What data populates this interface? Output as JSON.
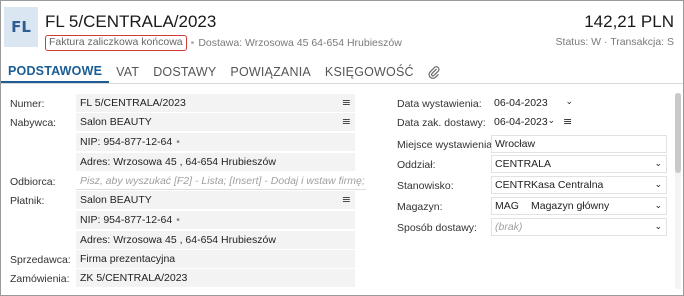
{
  "header": {
    "icon_text": "FL",
    "title": "FL 5/CENTRALA/2023",
    "doc_type": "Faktura zaliczkowa końcowa",
    "delivery": "Dostawa: Wrzosowa  45  64-654 Hrubieszów",
    "amount": "142,21 PLN",
    "status": "Status:  W  ·  Transakcja:  S"
  },
  "tabs": [
    {
      "label": "PODSTAWOWE",
      "active": true
    },
    {
      "label": "VAT"
    },
    {
      "label": "DOSTAWY"
    },
    {
      "label": "POWIĄZANIA"
    },
    {
      "label": "KSIĘGOWOŚĆ"
    }
  ],
  "left": {
    "numer_label": "Numer:",
    "numer_value": "FL 5/CENTRALA/2023",
    "nabywca_label": "Nabywca:",
    "nabywca_name": "Salon BEAUTY",
    "nabywca_nip": "NIP:  954-877-12-64",
    "nabywca_addr": "Adres:  Wrzosowa  45 , 64-654 Hrubieszów",
    "odbiorca_label": "Odbiorca:",
    "odbiorca_placeholder": "Pisz, aby wyszukać [F2] - Lista; [Insert] - Dodaj i wstaw firmę;",
    "platnik_label": "Płatnik:",
    "platnik_name": "Salon BEAUTY",
    "platnik_nip": "NIP:  954-877-12-64",
    "platnik_addr": "Adres:  Wrzosowa  45 , 64-654 Hrubieszów",
    "sprzedawca_label": "Sprzedawca:",
    "sprzedawca_value": "Firma prezentacyjna",
    "zamowienia_label": "Zamówienia:",
    "zamowienia_value": "ZK 5/CENTRALA/2023"
  },
  "right": {
    "data_wyst_label": "Data wystawienia:",
    "data_wyst_value": "06-04-2023",
    "data_zak_label": "Data zak. dostawy:",
    "data_zak_value": "06-04-2023",
    "miejsce_label": "Miejsce wystawienia:",
    "miejsce_value": "Wrocław",
    "oddzial_label": "Oddział:",
    "oddzial_value": "CENTRALA",
    "stanowisko_label": "Stanowisko:",
    "stanowisko_code": "CENTR",
    "stanowisko_name": "Kasa Centralna",
    "magazyn_label": "Magazyn:",
    "magazyn_code": "MAG",
    "magazyn_name": "Magazyn główny",
    "sposob_label": "Sposób dostawy:",
    "sposob_value": "(brak)"
  },
  "icons": {
    "menu": "hamburger-icon",
    "dropdown": "chevron-down-icon",
    "attachment": "paperclip-icon"
  }
}
